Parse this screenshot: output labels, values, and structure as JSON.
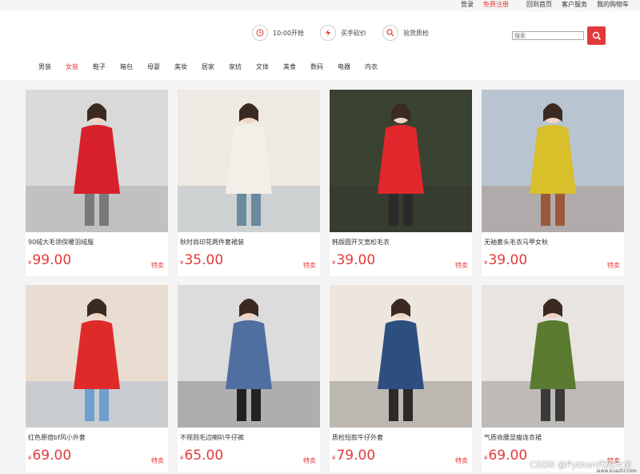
{
  "topbar": {
    "login": "登录",
    "register": "免费注册",
    "home": "回到首页",
    "service": "客户服务",
    "cart": "我的购物车"
  },
  "features": [
    {
      "icon": "clock-icon",
      "label": "10:00开抢"
    },
    {
      "icon": "lightning-icon",
      "label": "买手砍价"
    },
    {
      "icon": "search-icon",
      "label": "验货质检"
    }
  ],
  "search": {
    "placeholder": "搜索"
  },
  "nav": [
    {
      "label": "男装",
      "active": false
    },
    {
      "label": "女装",
      "active": true
    },
    {
      "label": "鞋子",
      "active": false
    },
    {
      "label": "箱包",
      "active": false
    },
    {
      "label": "母婴",
      "active": false
    },
    {
      "label": "美妆",
      "active": false
    },
    {
      "label": "居家",
      "active": false
    },
    {
      "label": "家纺",
      "active": false
    },
    {
      "label": "文体",
      "active": false
    },
    {
      "label": "美食",
      "active": false
    },
    {
      "label": "数码",
      "active": false
    },
    {
      "label": "电器",
      "active": false
    },
    {
      "label": "内衣",
      "active": false
    }
  ],
  "products": [
    {
      "title": "90绒大毛领保暖羽绒服",
      "currency": "¥",
      "price": "99.00",
      "tag": "特卖",
      "colors": {
        "bg": "#d9d9d9",
        "main": "#d8202a",
        "accent": "#7a7a7a"
      }
    },
    {
      "title": "秋时尚印花两件套裙装",
      "currency": "¥",
      "price": "35.00",
      "tag": "特卖",
      "colors": {
        "bg": "#eee9e2",
        "main": "#f2efe8",
        "accent": "#6a8aa0"
      }
    },
    {
      "title": "韩版圆开叉宽松毛衣",
      "currency": "¥",
      "price": "39.00",
      "tag": "特卖",
      "colors": {
        "bg": "#3a4232",
        "main": "#e1262c",
        "accent": "#2a2a2a"
      }
    },
    {
      "title": "无袖套头毛衣马甲女秋",
      "currency": "¥",
      "price": "39.00",
      "tag": "特卖",
      "colors": {
        "bg": "#b8c4cf",
        "main": "#d9bf2a",
        "accent": "#9a5a3a"
      }
    },
    {
      "title": "红色原宿bf风小外套",
      "currency": "¥",
      "price": "69.00",
      "tag": "特卖",
      "colors": {
        "bg": "#e8ddd0",
        "main": "#df2a2a",
        "accent": "#6f9fd1"
      }
    },
    {
      "title": "不规则毛边喇叭牛仔裤",
      "currency": "¥",
      "price": "65.00",
      "tag": "特卖",
      "colors": {
        "bg": "#dcdcdc",
        "main": "#4f6fa0",
        "accent": "#222222"
      }
    },
    {
      "title": "质检短款牛仔外套",
      "currency": "¥",
      "price": "79.00",
      "tag": "特卖",
      "colors": {
        "bg": "#ece6de",
        "main": "#2d4f80",
        "accent": "#2a2a2a"
      }
    },
    {
      "title": "气质收腰显瘦连衣裙",
      "currency": "¥",
      "price": "69.00",
      "tag": "特卖",
      "colors": {
        "bg": "#e8e5e0",
        "main": "#5a7a30",
        "accent": "#3a3a3a"
      }
    }
  ],
  "watermark": "CSDN @Python代码大全",
  "watermark_sub": "www.kuazhi.com"
}
